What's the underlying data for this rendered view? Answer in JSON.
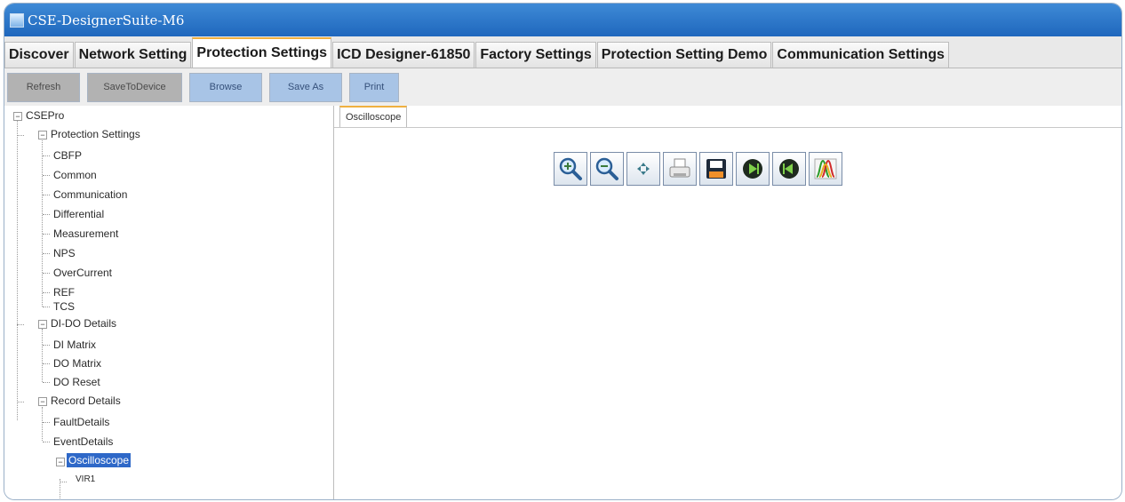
{
  "window": {
    "title": "CSE-DesignerSuite-M6"
  },
  "tabs": [
    {
      "label": "Discover"
    },
    {
      "label": "Network Setting"
    },
    {
      "label": "Protection Settings",
      "active": true
    },
    {
      "label": "ICD Designer-61850"
    },
    {
      "label": "Factory Settings"
    },
    {
      "label": "Protection Setting Demo"
    },
    {
      "label": "Communication Settings"
    }
  ],
  "toolbar": {
    "refresh": "Refresh",
    "save_to_device": "SaveToDevice",
    "browse": "Browse",
    "save_as": "Save As",
    "print": "Print"
  },
  "tree": {
    "root": "CSEPro",
    "protection": "Protection Settings",
    "cbfp": "CBFP",
    "common": "Common",
    "communication": "Communication",
    "differential": "Differential",
    "measurement": "Measurement",
    "nps": "NPS",
    "overcurrent": "OverCurrent",
    "ref": "REF",
    "tcs": "TCS",
    "dido": "DI-DO Details",
    "di_matrix": "DI Matrix",
    "do_matrix": "DO Matrix",
    "do_reset": "DO Reset",
    "record": "Record Details",
    "fault": "FaultDetails",
    "event": "EventDetails",
    "osc": "Oscilloscope",
    "partial": "VIR1"
  },
  "doc_tab": {
    "label": "Oscilloscope"
  },
  "scope_icons": [
    "zoom-in-icon",
    "zoom-out-icon",
    "pan-icon",
    "print-icon",
    "save-icon",
    "next-icon",
    "previous-icon",
    "waveform-icon"
  ],
  "colors": {
    "titlebar": "#2d78c8",
    "active_tab_accent": "#f0b040",
    "selection": "#2e68c8"
  }
}
